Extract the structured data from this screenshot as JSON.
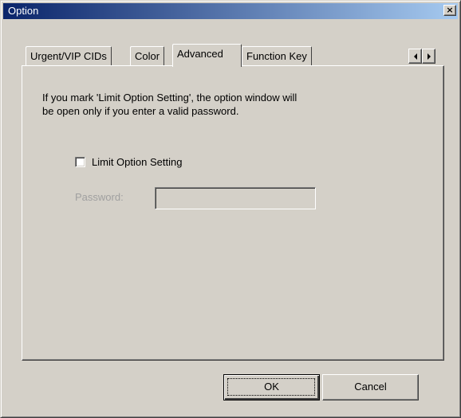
{
  "window": {
    "title": "Option",
    "close_glyph": "×"
  },
  "tabs": [
    {
      "label": "Urgent/VIP CIDs",
      "active": false
    },
    {
      "label": "Color",
      "active": false
    },
    {
      "label": "Advanced",
      "active": true
    },
    {
      "label": "Function Key",
      "active": false
    }
  ],
  "tab_scroll": {
    "left_icon": "arrow-left-icon",
    "right_icon": "arrow-right-icon"
  },
  "advanced": {
    "description_line1": "If you mark 'Limit Option Setting', the option window will",
    "description_line2": "be open only if you enter a valid password.",
    "limit_checkbox": {
      "label": "Limit Option Setting",
      "checked": false
    },
    "password": {
      "label": "Password:",
      "value": "",
      "enabled": false
    }
  },
  "buttons": {
    "ok_label": "OK",
    "cancel_label": "Cancel"
  },
  "colors": {
    "titlebar_start": "#0a246a",
    "titlebar_end": "#a6caf0",
    "face": "#d4d0c8",
    "disabled_text": "#a0a0a0"
  }
}
